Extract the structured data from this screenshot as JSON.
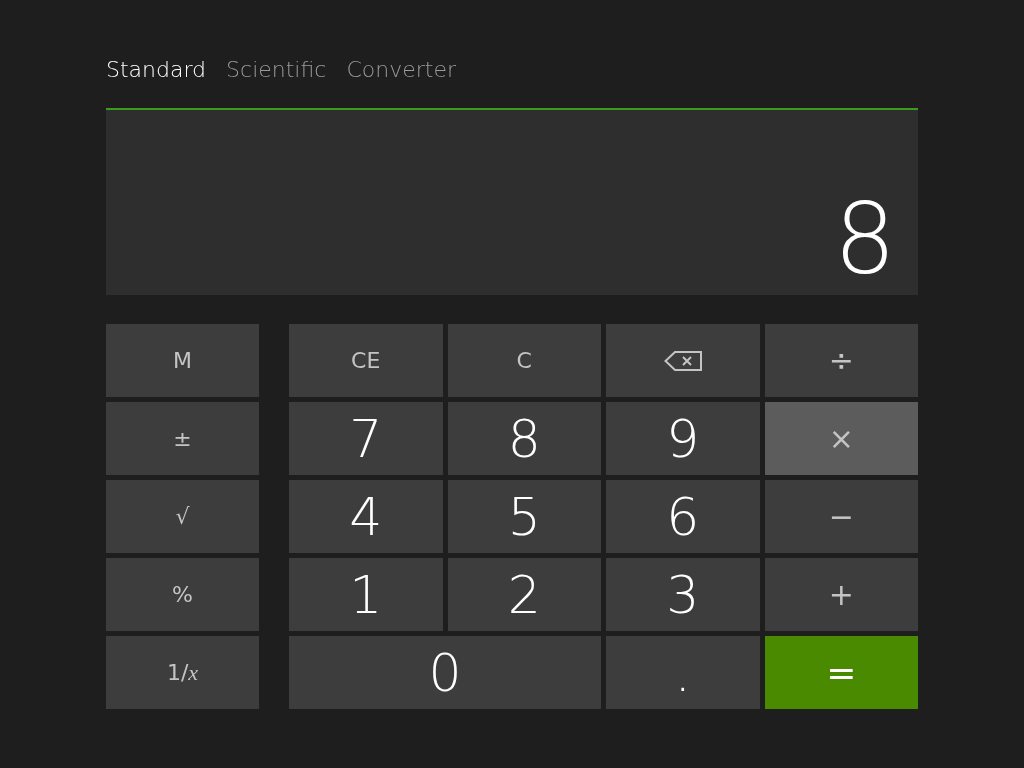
{
  "tabs": [
    {
      "label": "Standard",
      "selected": true
    },
    {
      "label": "Scientific",
      "selected": false
    },
    {
      "label": "Converter",
      "selected": false
    }
  ],
  "display": {
    "value": "8"
  },
  "keypad": {
    "side_keys": [
      {
        "label": "M",
        "kind": "function",
        "active": false
      },
      {
        "label": "±",
        "kind": "function",
        "active": false
      },
      {
        "label": "√",
        "kind": "function",
        "active": false
      },
      {
        "label": "%",
        "kind": "function",
        "active": false
      },
      {
        "label": "1/*x*",
        "kind": "function",
        "active": false
      }
    ],
    "keys": [
      {
        "label": "CE",
        "kind": "function",
        "wide": false,
        "active": false
      },
      {
        "label": "C",
        "kind": "function",
        "wide": false,
        "active": false
      },
      {
        "kind": "backspace",
        "wide": false,
        "active": false
      },
      {
        "label": "÷",
        "kind": "operator",
        "wide": false,
        "active": false
      },
      {
        "label": "7",
        "kind": "digit",
        "wide": false,
        "active": false
      },
      {
        "label": "8",
        "kind": "digit",
        "wide": false,
        "active": false
      },
      {
        "label": "9",
        "kind": "digit",
        "wide": false,
        "active": false
      },
      {
        "label": "×",
        "kind": "operator",
        "wide": false,
        "active": true
      },
      {
        "label": "4",
        "kind": "digit",
        "wide": false,
        "active": false
      },
      {
        "label": "5",
        "kind": "digit",
        "wide": false,
        "active": false
      },
      {
        "label": "6",
        "kind": "digit",
        "wide": false,
        "active": false
      },
      {
        "label": "−",
        "kind": "operator",
        "wide": false,
        "active": false
      },
      {
        "label": "1",
        "kind": "digit",
        "wide": false,
        "active": false
      },
      {
        "label": "2",
        "kind": "digit",
        "wide": false,
        "active": false
      },
      {
        "label": "3",
        "kind": "digit",
        "wide": false,
        "active": false
      },
      {
        "label": "+",
        "kind": "operator",
        "wide": false,
        "active": false
      },
      {
        "label": "0",
        "kind": "digit",
        "wide": true,
        "active": false
      },
      {
        "label": ".",
        "kind": "digit",
        "wide": false,
        "active": false
      },
      {
        "label": "=",
        "kind": "equals",
        "wide": false,
        "active": false
      }
    ]
  }
}
